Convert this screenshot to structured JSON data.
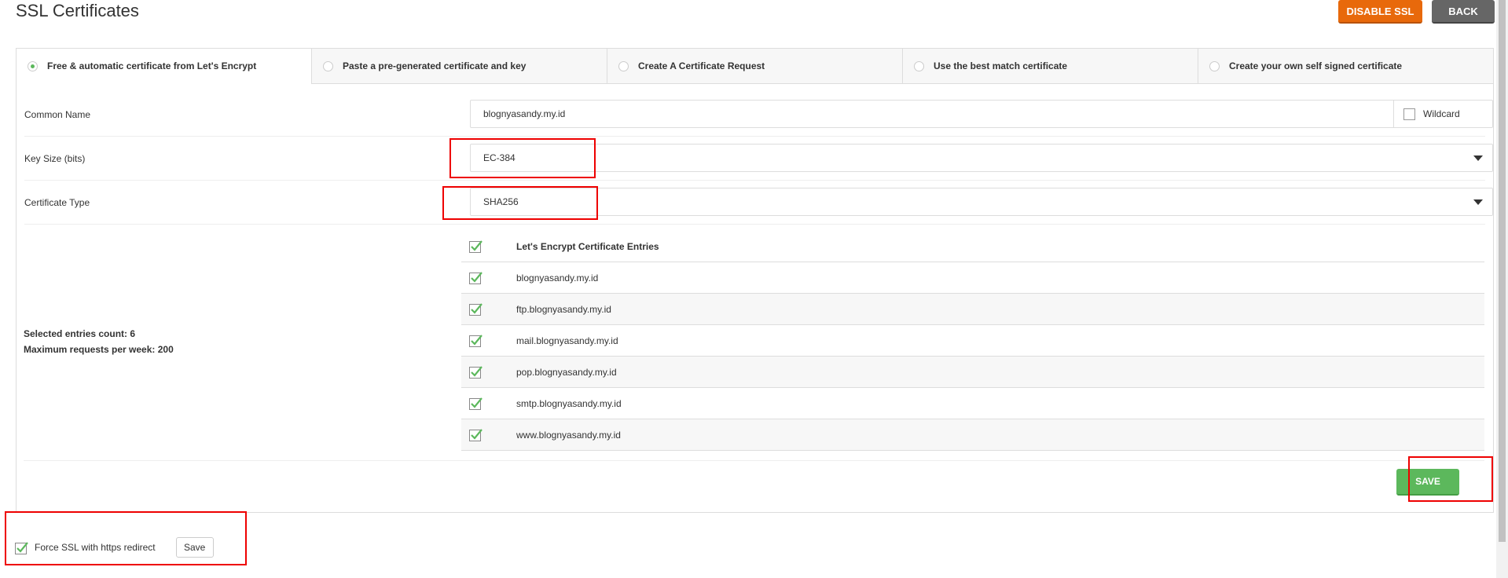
{
  "page": {
    "title": "SSL Certificates",
    "buttons": {
      "disable_ssl": "DISABLE SSL",
      "back": "BACK"
    }
  },
  "tabs": [
    {
      "label": "Free & automatic certificate from Let's Encrypt",
      "selected": true
    },
    {
      "label": "Paste a pre-generated certificate and key",
      "selected": false
    },
    {
      "label": "Create A Certificate Request",
      "selected": false
    },
    {
      "label": "Use the best match certificate",
      "selected": false
    },
    {
      "label": "Create your own self signed certificate",
      "selected": false
    }
  ],
  "form": {
    "common_name": {
      "label": "Common Name",
      "value": "blognyasandy.my.id",
      "wildcard_label": "Wildcard",
      "wildcard_checked": false
    },
    "key_size": {
      "label": "Key Size (bits)",
      "value": "EC-384"
    },
    "certificate_type": {
      "label": "Certificate Type",
      "value": "SHA256"
    }
  },
  "entries": {
    "header": "Let's Encrypt Certificate Entries",
    "items": [
      "blognyasandy.my.id",
      "ftp.blognyasandy.my.id",
      "mail.blognyasandy.my.id",
      "pop.blognyasandy.my.id",
      "smtp.blognyasandy.my.id",
      "www.blognyasandy.my.id"
    ]
  },
  "counts": {
    "selected": "Selected entries count: 6",
    "max_requests": "Maximum requests per week: 200"
  },
  "save_label": "SAVE",
  "force_ssl": {
    "label": "Force SSL with https redirect",
    "checked": true,
    "save_label": "Save"
  },
  "colors": {
    "accent_orange": "#e8690b",
    "success_green": "#5cb85c",
    "annotation_red": "#ee0000"
  },
  "icons": [
    "radio-selected-icon",
    "radio-icon",
    "checkbox-checked-icon",
    "dropdown-caret-icon"
  ]
}
